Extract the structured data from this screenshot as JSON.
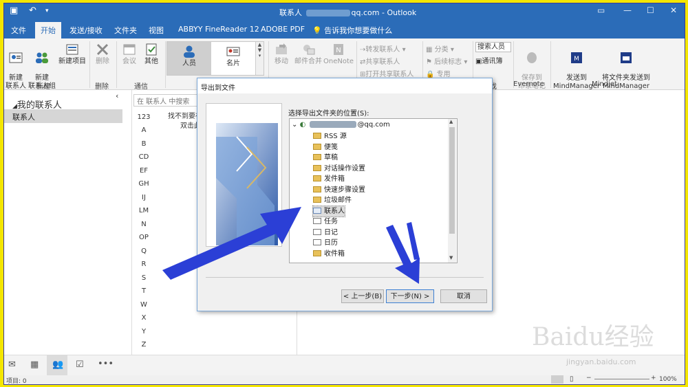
{
  "window": {
    "title_prefix": "联系人",
    "title_email_suffix": "qq.com",
    "title_app": "Outlook"
  },
  "menu": [
    "文件",
    "开始",
    "发送/接收",
    "文件夹",
    "视图",
    "ABBYY FineReader 12",
    "ADOBE PDF"
  ],
  "tell_me": "告诉我你想要做什么",
  "ribbon": {
    "new_contact": "新建\n联系人",
    "new_group": "新建\n联系人组",
    "new_items": "新建项目",
    "new_group_label": "新建",
    "delete": "删除",
    "delete_group_label": "删除",
    "meeting": "会议",
    "more": "其他",
    "comm_group_label": "通信",
    "view_people": "人员",
    "view_card": "名片",
    "move": "移动",
    "mail_merge": "邮件合并",
    "onenote": "OneNote",
    "forward_contact": "转发联系人",
    "share_contact": "共享联系人",
    "open_shared": "打开共享联系人",
    "categorize": "分类",
    "follow_up": "后续标志",
    "private": "专用",
    "search_people": "搜索人员",
    "address_book": "通讯簿",
    "find_label": "找",
    "save_evernote": "保存到\n印象笔记",
    "evernote_label": "Evernote",
    "send_mindmanager": "发送到\nMindManager",
    "send_folder_mindmanager": "将文件夹发送到\nMindManager",
    "mindjet_label": "Mindjet"
  },
  "nav": {
    "title": "我的联系人",
    "selected": "联系人"
  },
  "search_placeholder": "在 联系人 中搜索",
  "not_found": [
    "找不到要在",
    "双击此"
  ],
  "alphabet": [
    "123",
    "A",
    "B",
    "CD",
    "EF",
    "GH",
    "IJ",
    "LM",
    "N",
    "OP",
    "Q",
    "R",
    "S",
    "T",
    "W",
    "X",
    "Y",
    "Z"
  ],
  "status": {
    "items": "项目: 0",
    "zoom": "100%"
  },
  "dialog": {
    "title": "导出到文件",
    "prompt": "选择导出文件夹的位置(S):",
    "root_suffix": "@qq.com",
    "folders": [
      "RSS 源",
      "便笺",
      "草稿",
      "对话操作设置",
      "发件箱",
      "快速步骤设置",
      "垃圾邮件",
      "联系人",
      "任务",
      "日记",
      "日历",
      "收件箱"
    ],
    "selected_folder": "联系人",
    "back": "< 上一步(B)",
    "next": "下一步(N) >",
    "cancel": "取消"
  },
  "watermark": {
    "text": "Baidu经验",
    "url": "jingyan.baidu.com"
  },
  "colors": {
    "border_yellow": "#f4e600",
    "outlook_blue": "#2b6cb8",
    "arrow_blue": "#2b3fd6"
  }
}
